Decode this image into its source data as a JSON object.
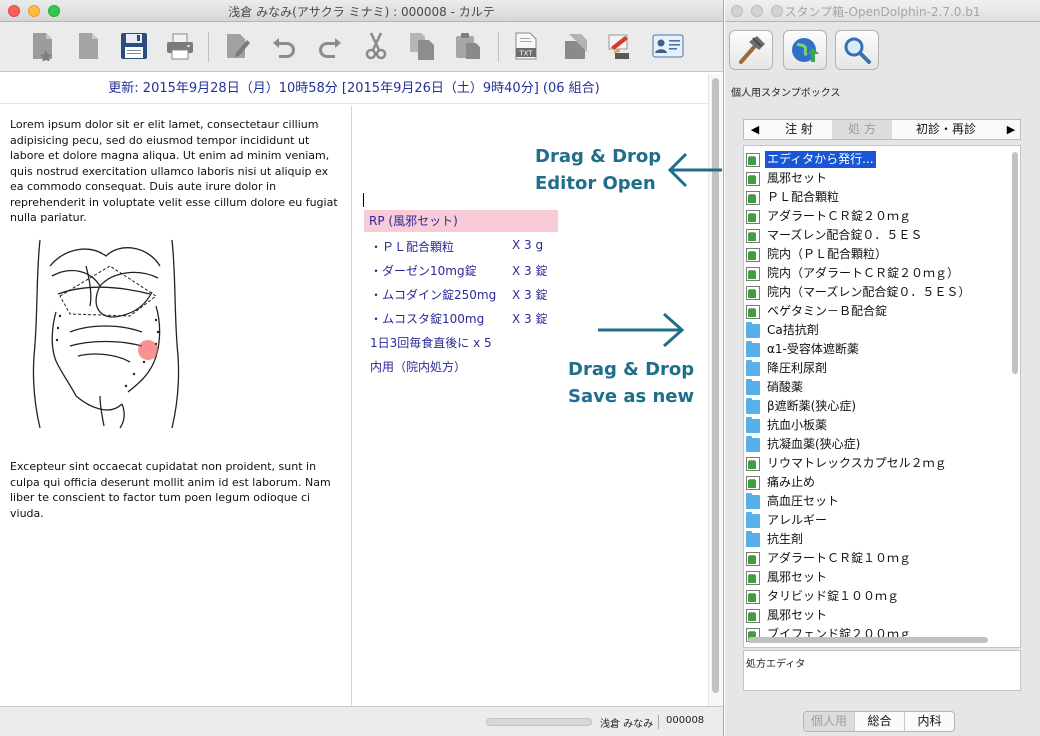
{
  "karte_window": {
    "title": "浅倉 みなみ(アサクラ ミナミ) : 000008 - カルテ",
    "toolbar_buttons": [
      "new-document-icon",
      "blank-document-icon",
      "save-icon",
      "print-icon",
      "edit-icon",
      "undo-icon",
      "redo-icon",
      "cut-icon",
      "copy-icon",
      "paste-icon",
      "txt-icon",
      "stamp-icon",
      "schema-icon",
      "patient-card-icon"
    ],
    "header": "更新: 2015年9月28日（月）10時58分 [2015年9月26日（土）9時40分] (06 組合)",
    "soa_text_1": "Lorem ipsum dolor sit er elit lamet, consectetaur cillium adipisicing pecu, sed do eiusmod tempor incididunt ut labore et dolore magna aliqua. Ut enim ad minim veniam, quis nostrud exercitation ullamco laboris nisi ut aliquip ex ea commodo consequat. Duis aute irure dolor in reprehenderit in voluptate velit esse cillum dolore eu fugiat nulla pariatur.",
    "soa_text_2": "Excepteur sint occaecat cupidatat non proident, sunt in  culpa qui officia deserunt mollit anim id est laborum. Nam liber te conscient to factor tum poen legum odioque ci viuda.",
    "rp": {
      "header": "RP (風邪セット)",
      "lines": [
        {
          "name": "・ＰＬ配合顆粒",
          "qty": "X 3  g"
        },
        {
          "name": "・ダーゼン10mg錠",
          "qty": "X 3  錠"
        },
        {
          "name": "・ムコダイン錠250mg",
          "qty": "X 3  錠"
        },
        {
          "name": "・ムコスタ錠100mg",
          "qty": "X 3  錠"
        }
      ],
      "usage": "1日3回毎食直後に x 5",
      "admin": "内用（院内処方）"
    },
    "status": {
      "patient_name": "浅倉 みなみ",
      "patient_id": "000008"
    }
  },
  "annotations": {
    "editor_open_line1": "Drag & Drop",
    "editor_open_line2": "Editor Open",
    "save_new_line1": "Drag & Drop",
    "save_new_line2": "Save as new"
  },
  "stamp_window": {
    "title": "スタンプ箱-OpenDolphin-2.7.0.b1",
    "tools": [
      "hammer-icon",
      "globe-upload-icon",
      "magnifier-icon"
    ],
    "label": "個人用スタンプボックス",
    "tabs": [
      {
        "label": "注 射",
        "active": false
      },
      {
        "label": "処 方",
        "active": true
      },
      {
        "label": "初診・再診",
        "active": false
      }
    ],
    "tree": [
      {
        "label": "エディタから発行...",
        "type": "doc",
        "selected": true
      },
      {
        "label": "風邪セット",
        "type": "doc"
      },
      {
        "label": "ＰＬ配合顆粒",
        "type": "doc"
      },
      {
        "label": "アダラートＣＲ錠２０ｍｇ",
        "type": "doc"
      },
      {
        "label": "マーズレン配合錠０．５ＥＳ",
        "type": "doc"
      },
      {
        "label": "院内（ＰＬ配合顆粒）",
        "type": "doc"
      },
      {
        "label": "院内（アダラートＣＲ錠２０ｍｇ）",
        "type": "doc"
      },
      {
        "label": "院内（マーズレン配合錠０．５ＥＳ）",
        "type": "doc"
      },
      {
        "label": "ベゲタミン－Ｂ配合錠",
        "type": "doc"
      },
      {
        "label": "Ca拮抗剤",
        "type": "folder"
      },
      {
        "label": "α1-受容体遮断薬",
        "type": "folder"
      },
      {
        "label": "降圧利尿剤",
        "type": "folder"
      },
      {
        "label": "硝酸薬",
        "type": "folder"
      },
      {
        "label": "β遮断薬(狭心症)",
        "type": "folder"
      },
      {
        "label": "抗血小板薬",
        "type": "folder"
      },
      {
        "label": "抗凝血薬(狭心症)",
        "type": "folder"
      },
      {
        "label": "リウマトレックスカプセル２ｍｇ",
        "type": "doc"
      },
      {
        "label": "痛み止め",
        "type": "doc"
      },
      {
        "label": "高血圧セット",
        "type": "folder"
      },
      {
        "label": "アレルギー",
        "type": "folder"
      },
      {
        "label": "抗生剤",
        "type": "folder"
      },
      {
        "label": "アダラートＣＲ錠１０ｍｇ",
        "type": "doc"
      },
      {
        "label": "風邪セット",
        "type": "doc"
      },
      {
        "label": "タリビッド錠１００ｍｇ",
        "type": "doc"
      },
      {
        "label": "風邪セット",
        "type": "doc"
      },
      {
        "label": "ブイフェンド錠２００ｍｇ",
        "type": "doc"
      }
    ],
    "editor_label": "処方エディタ",
    "bottom_tabs": [
      {
        "label": "個人用",
        "active": true
      },
      {
        "label": "総合",
        "active": false
      },
      {
        "label": "内科",
        "active": false
      }
    ],
    "colors": {
      "selection": "#1856d6",
      "rp_highlight": "#f9cbd7",
      "annotation": "#1f6e8c",
      "rp_text": "#2a2a96"
    }
  }
}
